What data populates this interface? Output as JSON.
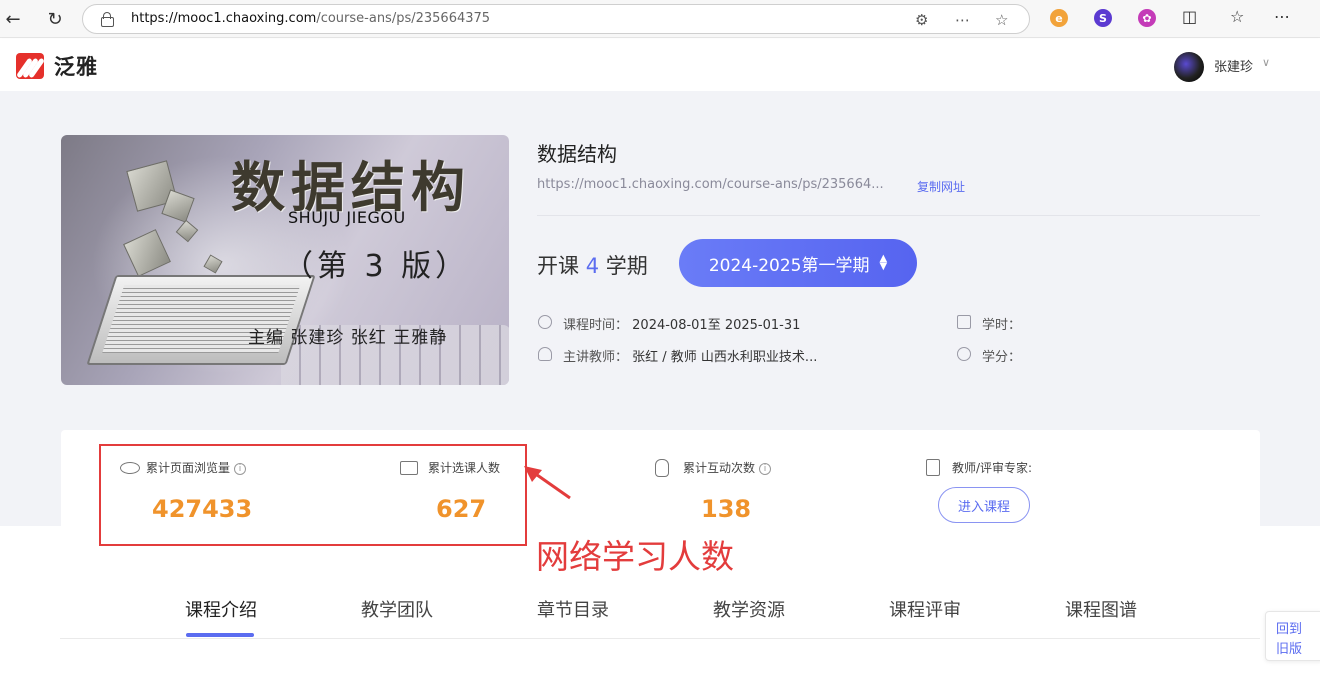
{
  "browser": {
    "url_host": "https://mooc1.chaoxing.com",
    "url_path": "/course-ans/ps/235664375"
  },
  "header": {
    "logo_text": "泛雅",
    "user_name": "张建珍"
  },
  "course": {
    "cover": {
      "title": "数据结构",
      "pinyin": "SHUJU JIEGOU",
      "edition": "（第 3 版）",
      "authors": "主编 张建珍 张红 王雅静"
    },
    "title": "数据结构",
    "url": "https://mooc1.chaoxing.com/course-ans/ps/235664...",
    "copy_label": "复制网址",
    "semesters_prefix": "开课",
    "semesters_count": "4",
    "semesters_suffix": "学期",
    "term_selected": "2024-2025第一学期",
    "time_label": "课程时间：",
    "time_value": "2024-08-01至 2025-01-31",
    "teacher_label": "主讲教师：",
    "teacher_value": "张红 / 教师 山西水利职业技术...",
    "hours_label": "学时：",
    "credits_label": "学分："
  },
  "stats": {
    "views_label": "累计页面浏览量",
    "views_value": "427433",
    "enroll_label": "累计选课人数",
    "enroll_value": "627",
    "interact_label": "累计互动次数",
    "interact_value": "138",
    "expert_label": "教师/评审专家:",
    "enter_label": "进入课程"
  },
  "annotation": {
    "text": "网络学习人数"
  },
  "tabs": [
    "课程介绍",
    "教学团队",
    "章节目录",
    "教学资源",
    "课程评审",
    "课程图谱"
  ],
  "back_old": {
    "line1": "回到",
    "line2": "旧版"
  },
  "colors": {
    "accent": "#5b6cf0",
    "stat": "#f0932b",
    "annotation": "#e33c3c"
  }
}
